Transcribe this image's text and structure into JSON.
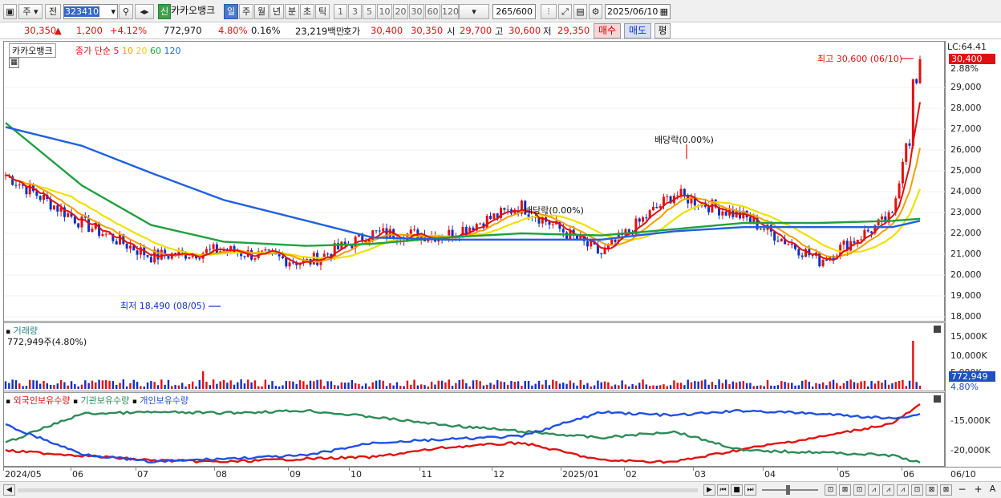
{
  "toolbar": {
    "market_label": "주",
    "prev_label": "전",
    "stock_code": "323410",
    "credit_label": "신",
    "stock_name": "카카오뱅크",
    "periods": [
      "일",
      "주",
      "월",
      "년",
      "분",
      "초",
      "틱"
    ],
    "minutes": [
      "1",
      "3",
      "5",
      "10",
      "20",
      "30",
      "60",
      "120"
    ],
    "count_value": "265",
    "count_total": "/600",
    "date_value": "2025/06/10"
  },
  "quote": {
    "price": "30,350",
    "arrow": "▲",
    "change": "1,200",
    "change_pct": "+4.12%",
    "volume": "772,970",
    "turnover_pct": "4.80%",
    "ratio_pct": "0.16%",
    "amount": "23,219백만",
    "ask_label": "호가",
    "ask": "30,400",
    "bid": "30,350",
    "open_label": "시",
    "open": "29,700",
    "high_label": "고",
    "high": "30,600",
    "low_label": "저",
    "low": "29,350",
    "buy_label": "매수",
    "sell_label": "매도",
    "eval_label": "평"
  },
  "price_panel": {
    "name_tag": "카카오뱅크",
    "ma_title": "종가 단순",
    "ma_periods": [
      "5",
      "10",
      "20",
      "60",
      "120"
    ],
    "lc_label": "LC:64.41",
    "last_price_tag": "30,400",
    "pct_tag": "2.88%",
    "high_note": "최고 30,600 (06/10)",
    "low_note": "최저 18,490 (08/05)",
    "dividend_note_1": "배당락(0.00%)",
    "dividend_note_2": "배당락(0.00%)",
    "y_ticks": [
      "29,000",
      "28,000",
      "27,000",
      "26,000",
      "25,000",
      "24,000",
      "23,000",
      "22,000",
      "21,000",
      "20,000",
      "19,000",
      "18,000"
    ]
  },
  "volume_panel": {
    "title": "거래량",
    "value": "772,949주(4.80%)",
    "y_ticks": [
      "15,000K",
      "10,000K",
      "5,000K"
    ],
    "last_tag": "772,949",
    "pct_tag": "4.80%"
  },
  "holding_panel": {
    "legend": [
      "외국인보유수량",
      "기관보유수량",
      "개인보유수량"
    ],
    "y_ticks": [
      "-15,000K",
      "-20,000K"
    ]
  },
  "x_axis": [
    "2024/05",
    "06",
    "07",
    "08",
    "09",
    "10",
    "11",
    "12",
    "2025/01",
    "02",
    "03",
    "04",
    "05",
    "06"
  ],
  "x_axis_right": "06/10",
  "colors": {
    "ma5": "#e01010",
    "ma10": "#f0a000",
    "ma20": "#f0e000",
    "ma60": "#20a040",
    "ma120": "#2060e0",
    "foreign": "#e01010",
    "institution": "#2e8b57",
    "individual": "#2050e0"
  },
  "chart_data": {
    "type": "line",
    "x": [
      "2024/05",
      "06",
      "07",
      "08",
      "09",
      "10",
      "11",
      "12",
      "2025/01",
      "02",
      "03",
      "04",
      "05",
      "06"
    ],
    "series": [
      {
        "name": "종가",
        "values": [
          24800,
          22500,
          20900,
          21200,
          20600,
          22000,
          21900,
          23300,
          21000,
          23900,
          22800,
          20700,
          22800,
          30350
        ]
      },
      {
        "name": "120",
        "values": [
          27100,
          26200,
          24900,
          23600,
          22600,
          21800,
          21700,
          21700,
          21700,
          22100,
          22300,
          22300,
          22300,
          22600
        ]
      },
      {
        "name": "60",
        "values": [
          27300,
          24300,
          22400,
          21600,
          21400,
          21500,
          21800,
          22000,
          21900,
          22200,
          22500,
          22500,
          22600,
          22700
        ]
      }
    ],
    "ylim": [
      18000,
      30600
    ]
  }
}
